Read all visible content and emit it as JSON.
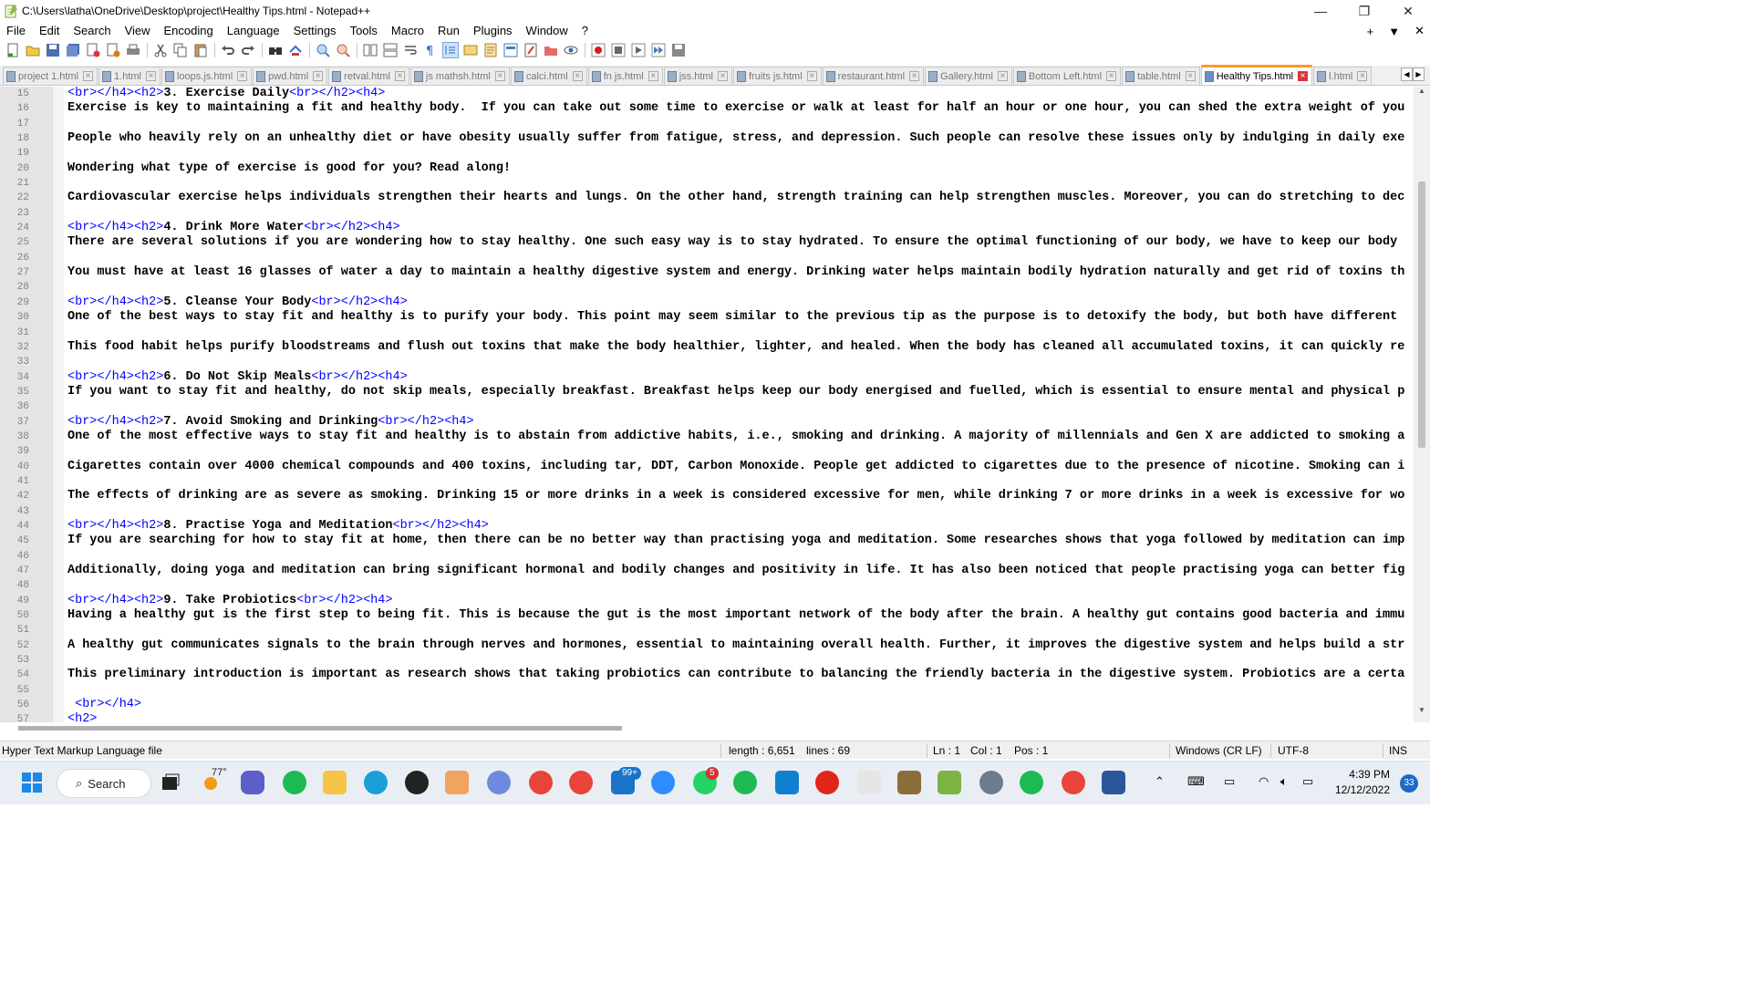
{
  "window": {
    "title": "C:\\Users\\latha\\OneDrive\\Desktop\\project\\Healthy Tips.html - Notepad++",
    "controls": [
      "—",
      "❐",
      "✕"
    ]
  },
  "menu": {
    "items": [
      "File",
      "Edit",
      "Search",
      "View",
      "Encoding",
      "Language",
      "Settings",
      "Tools",
      "Macro",
      "Run",
      "Plugins",
      "Window",
      "?"
    ],
    "right": [
      "+",
      "▼",
      "✕"
    ]
  },
  "tabs": [
    {
      "label": "project 1.html"
    },
    {
      "label": "1.html"
    },
    {
      "label": "loops.js.html"
    },
    {
      "label": "pwd.html"
    },
    {
      "label": "retval.html"
    },
    {
      "label": "js mathsh.html"
    },
    {
      "label": "calci.html"
    },
    {
      "label": "fn js.html"
    },
    {
      "label": "jss.html"
    },
    {
      "label": "fruits js.html"
    },
    {
      "label": "restaurant.html"
    },
    {
      "label": "Gallery.html"
    },
    {
      "label": "Bottom Left.html"
    },
    {
      "label": "table.html"
    },
    {
      "label": "Healthy Tips.html",
      "active": true
    },
    {
      "label": "l.html"
    }
  ],
  "editor": {
    "lines": [
      {
        "n": "15",
        "tag1": "<br></h4><h2>",
        "text": "3. Exercise Daily",
        "tag2": "<br></h2><h4>"
      },
      {
        "n": "16",
        "text": "Exercise is key to maintaining a fit and healthy body.  If you can take out some time to exercise or walk at least for half an hour or one hour, you can shed the extra weight of you"
      },
      {
        "n": "17",
        "text": ""
      },
      {
        "n": "18",
        "text": "People who heavily rely on an unhealthy diet or have obesity usually suffer from fatigue, stress, and depression. Such people can resolve these issues only by indulging in daily exe"
      },
      {
        "n": "19",
        "text": ""
      },
      {
        "n": "20",
        "text": "Wondering what type of exercise is good for you? Read along!"
      },
      {
        "n": "21",
        "text": ""
      },
      {
        "n": "22",
        "text": "Cardiovascular exercise helps individuals strengthen their hearts and lungs. On the other hand, strength training can help strengthen muscles. Moreover, you can do stretching to dec"
      },
      {
        "n": "23",
        "text": ""
      },
      {
        "n": "24",
        "tag1": "<br></h4><h2>",
        "text": "4. Drink More Water",
        "tag2": "<br></h2><h4>"
      },
      {
        "n": "25",
        "text": "There are several solutions if you are wondering how to stay healthy. One such easy way is to stay hydrated. To ensure the optimal functioning of our body, we have to keep our body"
      },
      {
        "n": "26",
        "text": ""
      },
      {
        "n": "27",
        "text": "You must have at least 16 glasses of water a day to maintain a healthy digestive system and energy. Drinking water helps maintain bodily hydration naturally and get rid of toxins th"
      },
      {
        "n": "28",
        "text": ""
      },
      {
        "n": "29",
        "tag1": "<br></h4><h2>",
        "text": "5. Cleanse Your Body",
        "tag2": "<br></h2><h4>"
      },
      {
        "n": "30",
        "text": "One of the best ways to stay fit and healthy is to purify your body. This point may seem similar to the previous tip as the purpose is to detoxify the body, but both have different"
      },
      {
        "n": "31",
        "text": ""
      },
      {
        "n": "32",
        "text": "This food habit helps purify bloodstreams and flush out toxins that make the body healthier, lighter, and healed. When the body has cleaned all accumulated toxins, it can quickly re"
      },
      {
        "n": "33",
        "text": ""
      },
      {
        "n": "34",
        "tag1": "<br></h4><h2>",
        "text": "6. Do Not Skip Meals",
        "tag2": "<br></h2><h4>"
      },
      {
        "n": "35",
        "text": "If you want to stay fit and healthy, do not skip meals, especially breakfast. Breakfast helps keep our body energised and fuelled, which is essential to ensure mental and physical p"
      },
      {
        "n": "36",
        "text": ""
      },
      {
        "n": "37",
        "tag1": "<br></h4><h2>",
        "text": "7. Avoid Smoking and Drinking",
        "tag2": "<br></h2><h4>"
      },
      {
        "n": "38",
        "text": "One of the most effective ways to stay fit and healthy is to abstain from addictive habits, i.e., smoking and drinking. A majority of millennials and Gen X are addicted to smoking a"
      },
      {
        "n": "39",
        "text": ""
      },
      {
        "n": "40",
        "text": "Cigarettes contain over 4000 chemical compounds and 400 toxins, including tar, DDT, Carbon Monoxide. People get addicted to cigarettes due to the presence of nicotine. Smoking can i"
      },
      {
        "n": "41",
        "text": ""
      },
      {
        "n": "42",
        "text": "The effects of drinking are as severe as smoking. Drinking 15 or more drinks in a week is considered excessive for men, while drinking 7 or more drinks in a week is excessive for wo"
      },
      {
        "n": "43",
        "text": ""
      },
      {
        "n": "44",
        "tag1": "<br></h4><h2>",
        "text": "8. Practise Yoga and Meditation",
        "tag2": "<br></h2><h4>"
      },
      {
        "n": "45",
        "text": "If you are searching for how to stay fit at home, then there can be no better way than practising yoga and meditation. Some researches shows that yoga followed by meditation can imp"
      },
      {
        "n": "46",
        "text": ""
      },
      {
        "n": "47",
        "text": "Additionally, doing yoga and meditation can bring significant hormonal and bodily changes and positivity in life. It has also been noticed that people practising yoga can better fig"
      },
      {
        "n": "48",
        "text": ""
      },
      {
        "n": "49",
        "tag1": "<br></h4><h2>",
        "text": "9. Take Probiotics",
        "tag2": "<br></h2><h4>"
      },
      {
        "n": "50",
        "text": "Having a healthy gut is the first step to being fit. This is because the gut is the most important network of the body after the brain. A healthy gut contains good bacteria and immu"
      },
      {
        "n": "51",
        "text": ""
      },
      {
        "n": "52",
        "text": "A healthy gut communicates signals to the brain through nerves and hormones, essential to maintaining overall health. Further, it improves the digestive system and helps build a str"
      },
      {
        "n": "53",
        "text": ""
      },
      {
        "n": "54",
        "text": "This preliminary introduction is important as research shows that taking probiotics can contribute to balancing the friendly bacteria in the digestive system. Probiotics are a certa"
      },
      {
        "n": "55",
        "text": ""
      },
      {
        "n": "56",
        "tag1": " <br></h4>",
        "text": ""
      },
      {
        "n": "57",
        "tag1": "<h2>",
        "text": ""
      }
    ]
  },
  "status": {
    "file_type": "Hyper Text Markup Language file",
    "length": "length : 6,651",
    "lines": "lines : 69",
    "ln": "Ln : 1",
    "col": "Col : 1",
    "pos": "Pos : 1",
    "eol": "Windows (CR LF)",
    "encoding": "UTF-8",
    "mode": "INS"
  },
  "taskbar": {
    "search_label": "Search",
    "weather": "77°",
    "mail_badge": "99+",
    "whatsapp_badge": "5",
    "time": "4:39 PM",
    "date": "12/12/2022",
    "notifications": "33"
  },
  "colors": {
    "tag": "#0000ff",
    "active_tab_accent": "#fa9c2a",
    "tab_close_active": "#d9363e"
  }
}
